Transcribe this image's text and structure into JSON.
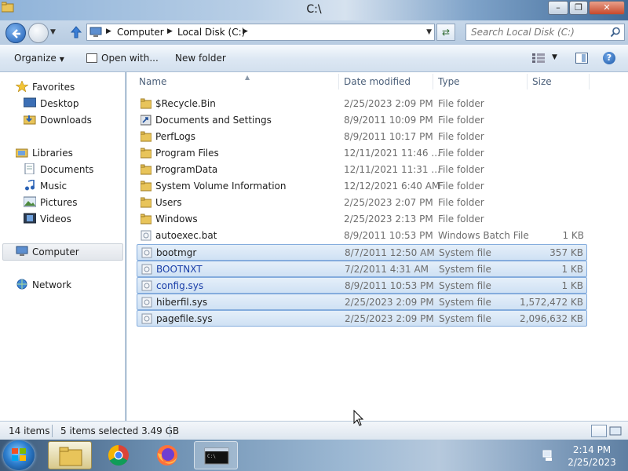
{
  "window": {
    "title": "C:\\"
  },
  "address": {
    "crumbs": [
      "Computer",
      "Local Disk (C:)"
    ],
    "search_placeholder": "Search Local Disk (C:)"
  },
  "toolbar": {
    "organize": "Organize",
    "open_with": "Open with...",
    "new_folder": "New folder"
  },
  "nav": {
    "favorites": "Favorites",
    "desktop": "Desktop",
    "downloads": "Downloads",
    "libraries": "Libraries",
    "documents": "Documents",
    "music": "Music",
    "pictures": "Pictures",
    "videos": "Videos",
    "computer": "Computer",
    "network": "Network"
  },
  "columns": {
    "name": "Name",
    "date": "Date modified",
    "type": "Type",
    "size": "Size"
  },
  "files": [
    {
      "name": "$Recycle.Bin",
      "date": "2/25/2023 2:09 PM",
      "type": "File folder",
      "size": "",
      "icon": "folder-icon",
      "selected": false
    },
    {
      "name": "Documents and Settings",
      "date": "8/9/2011 10:09 PM",
      "type": "File folder",
      "size": "",
      "icon": "shortcut-folder-icon",
      "selected": false
    },
    {
      "name": "PerfLogs",
      "date": "8/9/2011 10:17 PM",
      "type": "File folder",
      "size": "",
      "icon": "folder-icon",
      "selected": false
    },
    {
      "name": "Program Files",
      "date": "12/11/2021 11:46 ...",
      "type": "File folder",
      "size": "",
      "icon": "folder-icon",
      "selected": false
    },
    {
      "name": "ProgramData",
      "date": "12/11/2021 11:31 ...",
      "type": "File folder",
      "size": "",
      "icon": "folder-icon",
      "selected": false
    },
    {
      "name": "System Volume Information",
      "date": "12/12/2021 6:40 AM",
      "type": "File folder",
      "size": "",
      "icon": "folder-icon",
      "selected": false
    },
    {
      "name": "Users",
      "date": "2/25/2023 2:07 PM",
      "type": "File folder",
      "size": "",
      "icon": "folder-icon",
      "selected": false
    },
    {
      "name": "Windows",
      "date": "2/25/2023 2:13 PM",
      "type": "File folder",
      "size": "",
      "icon": "folder-icon",
      "selected": false
    },
    {
      "name": "autoexec.bat",
      "date": "8/9/2011 10:53 PM",
      "type": "Windows Batch File",
      "size": "1 KB",
      "icon": "batch-file-icon",
      "selected": false
    },
    {
      "name": "bootmgr",
      "date": "8/7/2011 12:50 AM",
      "type": "System file",
      "size": "357 KB",
      "icon": "system-file-icon",
      "selected": true
    },
    {
      "name": "BOOTNXT",
      "date": "7/2/2011 4:31 AM",
      "type": "System file",
      "size": "1 KB",
      "icon": "system-file-icon",
      "selected": true
    },
    {
      "name": "config.sys",
      "date": "8/9/2011 10:53 PM",
      "type": "System file",
      "size": "1 KB",
      "icon": "system-file-icon",
      "selected": true
    },
    {
      "name": "hiberfil.sys",
      "date": "2/25/2023 2:09 PM",
      "type": "System file",
      "size": "1,572,472 KB",
      "icon": "system-file-icon",
      "selected": true
    },
    {
      "name": "pagefile.sys",
      "date": "2/25/2023 2:09 PM",
      "type": "System file",
      "size": "2,096,632 KB",
      "icon": "system-file-icon",
      "selected": true
    }
  ],
  "status": {
    "item_count": "14 items",
    "selection": "5 items selected 3.49 GB"
  },
  "taskbar": {
    "time": "2:14 PM",
    "date": "2/25/2023"
  }
}
